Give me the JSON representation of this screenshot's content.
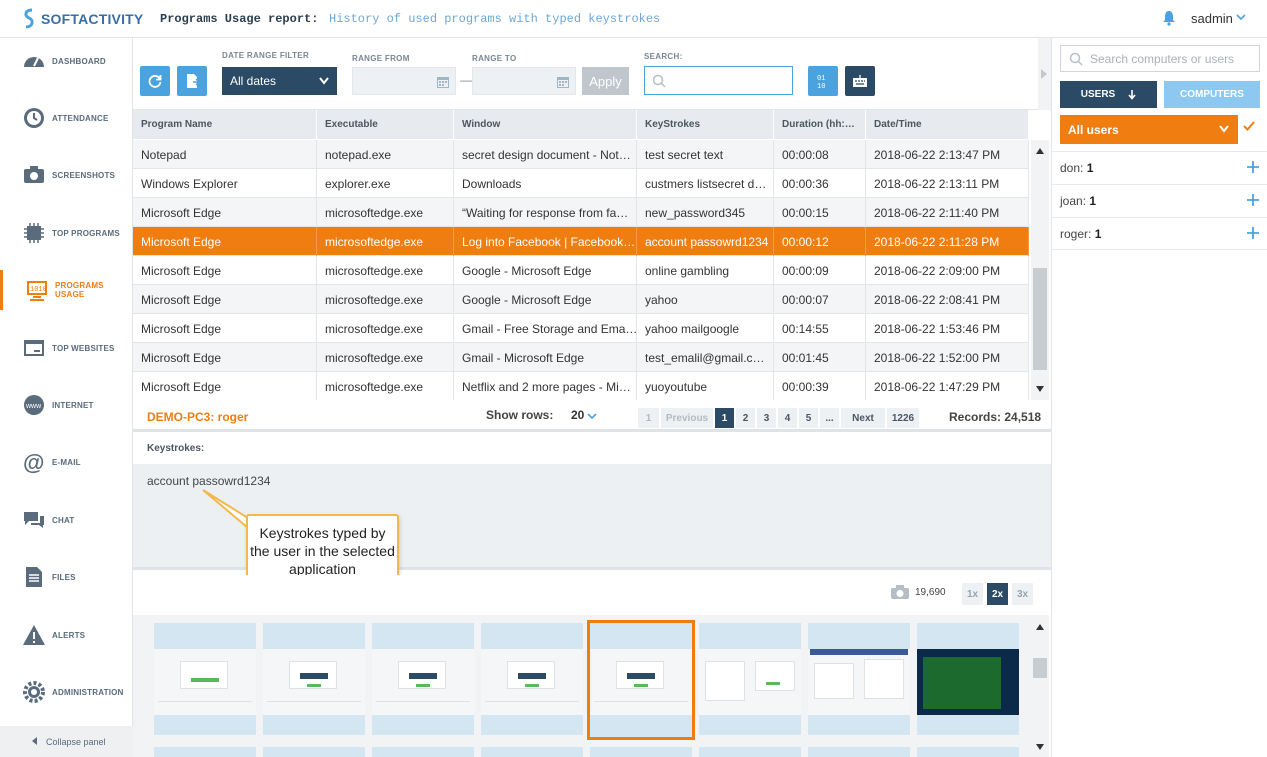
{
  "app": {
    "logo_text": "SOFTACTIVITY",
    "report_title": "Programs Usage report:",
    "report_subtitle": "History of used programs with typed keystrokes",
    "username": "sadmin"
  },
  "sidebar": {
    "items": [
      {
        "label": "DASHBOARD",
        "icon": "dashboard-icon"
      },
      {
        "label": "ATTENDANCE",
        "icon": "clock-icon"
      },
      {
        "label": "SCREENSHOTS",
        "icon": "camera-icon"
      },
      {
        "label": "TOP PROGRAMS",
        "icon": "chip-icon"
      },
      {
        "label": "PROGRAMS USAGE",
        "icon": "monitor-icon"
      },
      {
        "label": "TOP WEBSITES",
        "icon": "browser-icon"
      },
      {
        "label": "INTERNET",
        "icon": "globe-icon"
      },
      {
        "label": "E-MAIL",
        "icon": "at-icon"
      },
      {
        "label": "CHAT",
        "icon": "chat-icon"
      },
      {
        "label": "FILES",
        "icon": "file-icon"
      },
      {
        "label": "ALERTS",
        "icon": "alert-icon"
      },
      {
        "label": "ADMINISTRATION",
        "icon": "gear-icon"
      }
    ],
    "active_index": 4,
    "collapse_label": "Collapse panel"
  },
  "toolbar": {
    "date_range_label": "DATE RANGE FILTER",
    "date_range_value": "All dates",
    "range_from_label": "RANGE FROM",
    "range_to_label": "RANGE TO",
    "range_dash": "—",
    "apply_label": "Apply",
    "search_label": "SEARCH:"
  },
  "table": {
    "columns": [
      "Program Name",
      "Executable",
      "Window",
      "KeyStrokes",
      "Duration (hh:…",
      "Date/Time"
    ],
    "rows": [
      [
        "Notepad",
        "notepad.exe",
        "secret design document - Not…",
        "test secret text",
        "00:00:08",
        "2018-06-22 2:13:47 PM"
      ],
      [
        "Windows Explorer",
        "explorer.exe",
        "Downloads",
        "custmers listsecret d…",
        "00:00:36",
        "2018-06-22 2:13:11 PM"
      ],
      [
        "Microsoft Edge",
        "microsoftedge.exe",
        "“Waiting for response from fa…",
        "new_password345",
        "00:00:15",
        "2018-06-22 2:11:40 PM"
      ],
      [
        "Microsoft Edge",
        "microsoftedge.exe",
        "Log into Facebook | Facebook…",
        "account passowrd1234",
        "00:00:12",
        "2018-06-22 2:11:28 PM"
      ],
      [
        "Microsoft Edge",
        "microsoftedge.exe",
        "Google - Microsoft Edge",
        "online gambling",
        "00:00:09",
        "2018-06-22 2:09:00 PM"
      ],
      [
        "Microsoft Edge",
        "microsoftedge.exe",
        "Google - Microsoft Edge",
        "yahoo",
        "00:00:07",
        "2018-06-22 2:08:41 PM"
      ],
      [
        "Microsoft Edge",
        "microsoftedge.exe",
        "Gmail - Free Storage and Ema…",
        "yahoo mailgoogle",
        "00:14:55",
        "2018-06-22 1:53:46 PM"
      ],
      [
        "Microsoft Edge",
        "microsoftedge.exe",
        "Gmail - Microsoft Edge",
        "test_emalil@gmail.c…",
        "00:01:45",
        "2018-06-22 1:52:00 PM"
      ],
      [
        "Microsoft Edge",
        "microsoftedge.exe",
        "Netflix and 2 more pages - Mi…",
        "yuoyoutube",
        "00:00:39",
        "2018-06-22 1:47:29 PM"
      ]
    ],
    "selected_row": 3
  },
  "pager": {
    "pc_name": "DEMO-PC3: roger",
    "show_rows_label": "Show rows:",
    "rows_value": "20",
    "first": "1",
    "previous": "Previous",
    "pages": [
      "1",
      "2",
      "3",
      "4",
      "5"
    ],
    "ellipsis": "...",
    "next": "Next",
    "last": "1226",
    "records": "Records: 24,518"
  },
  "keystrokes": {
    "label": "Keystrokes:",
    "text": "account passowrd1234",
    "callout": "Keystrokes typed by the user in the selected application"
  },
  "screenshots": {
    "count": "19,690",
    "zoom": [
      "1x",
      "2x",
      "3x"
    ],
    "active_zoom": "2x"
  },
  "right_panel": {
    "search_placeholder": "Search computers or users",
    "users_tab": "USERS",
    "computers_tab": "COMPUTERS",
    "all_users": "All users",
    "users": [
      {
        "name": "don:",
        "count": "1"
      },
      {
        "name": "joan:",
        "count": "1"
      },
      {
        "name": "roger:",
        "count": "1"
      }
    ]
  },
  "colors": {
    "accent": "#ef7d10",
    "primary_dark": "#2b4a66",
    "primary_light": "#4aa3df"
  }
}
